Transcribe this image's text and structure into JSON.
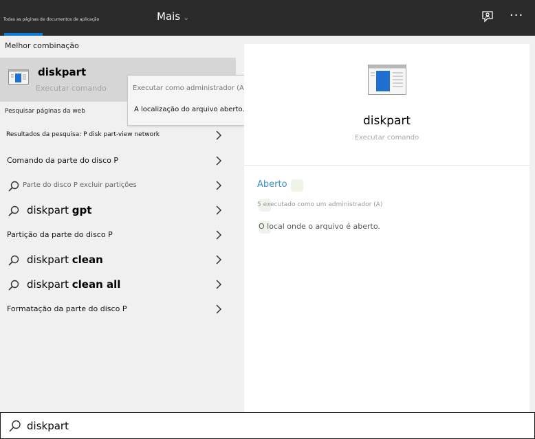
{
  "topbar": {
    "tab_all_label": "Todas as páginas de documentos de aplicação",
    "more_label": "Mais",
    "more_chevron": "⌄",
    "more_options_glyph": "···"
  },
  "best_match": {
    "heading": "Melhor combinação",
    "title": "diskpart",
    "subtitle": "Executar comando"
  },
  "context_menu": {
    "run_as_admin": "Executar como administrador (A)",
    "open_location": "A localização do arquivo aberto."
  },
  "web_section": {
    "heading": "Pesquisar páginas da web",
    "items": [
      {
        "text": "Resultados da pesquisa: P disk part-view network"
      },
      {
        "text": "Comando da parte do disco P"
      },
      {
        "text": "Parte do disco P excluir partições"
      },
      {
        "prefix": "diskpart ",
        "bold": "gpt"
      },
      {
        "text": "Partição da parte do disco P"
      },
      {
        "prefix": "diskpart ",
        "bold": "clean"
      },
      {
        "prefix": "diskpart ",
        "bold": "clean all"
      },
      {
        "text": "Formatação da parte do disco P"
      }
    ]
  },
  "preview": {
    "name": "diskpart",
    "type": "Executar comando",
    "actions": {
      "open": "Aberto",
      "run_admin": "5 executado como um administrador (A)",
      "open_location": "O local onde o arquivo é aberto."
    }
  },
  "search": {
    "value": "diskpart"
  },
  "colors": {
    "accent": "#0a7bd6",
    "topbar": "#2b2b2b",
    "link": "#3b8fcc"
  }
}
